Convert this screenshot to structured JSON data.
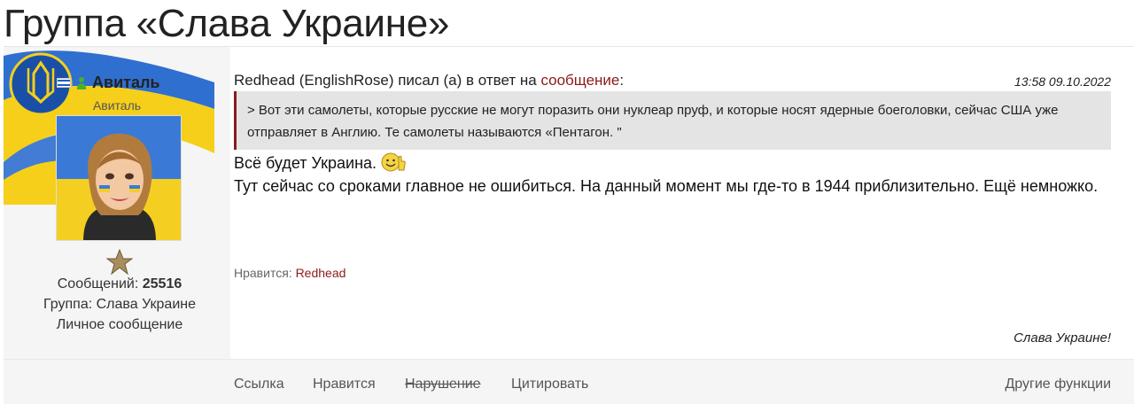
{
  "group": {
    "title": "Группа «Слава Украине»"
  },
  "user": {
    "name": "Авиталь",
    "title": "Авиталь",
    "messages_label": "Сообщений:",
    "messages_count": "25516",
    "group_label": "Группа: Слава Украине",
    "private_message": "Личное сообщение",
    "flag_icon": "israel-flag-icon",
    "status_icon": "person-icon"
  },
  "post": {
    "reply_prefix": "Redhead (EnglishRose) писал (а) в ответ на",
    "reply_link": "сообщение",
    "reply_suffix": ":",
    "time": "13:58 09.10.2022",
    "quote": "> Вот эти самолеты, которые русские не могут поразить они нуклеар пруф, и которые носят ядерные боеголовки, сейчас США уже отправляет в Англию. Те самолеты называются «Пентагон. \"",
    "message_line1": "Всё будет Украина.",
    "message_line2": "Тут сейчас со сроками главное не ошибиться. На данный момент мы где-то в 1944 приблизительно. Ещё немножко.",
    "likes_label": "Нравится:",
    "likes_user": "Redhead",
    "signature": "Слава Украине!"
  },
  "actions": {
    "link": "Ссылка",
    "like": "Нравится",
    "report": "Нарушение",
    "quote": "Цитировать",
    "other": "Другие функции"
  },
  "colors": {
    "accent": "#8b1a1a",
    "panel_bg": "#f5f5f5",
    "quote_bg": "#e4e4e4",
    "ua_blue": "#2f6fd0",
    "ua_yellow": "#f5cf1a"
  }
}
